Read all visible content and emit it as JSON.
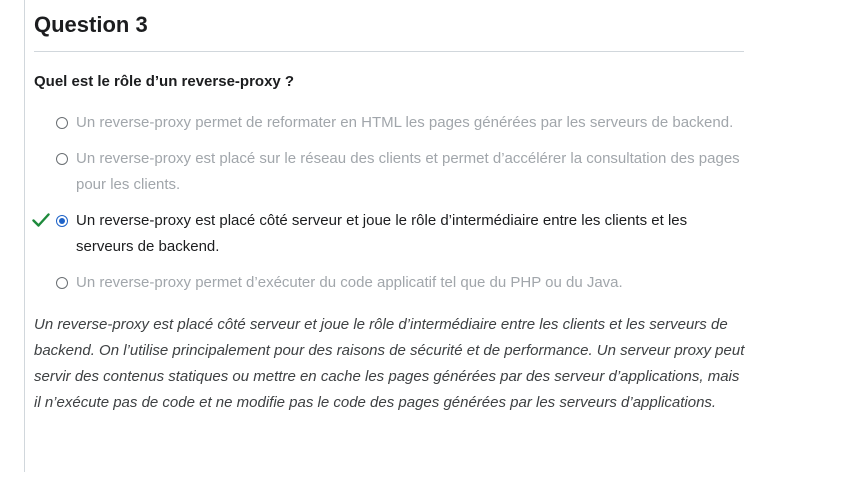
{
  "question": {
    "title": "Question 3",
    "prompt": "Quel est le rôle d’un reverse-proxy ?"
  },
  "options": [
    {
      "text": "Un reverse-proxy permet de reformater en HTML les pages générées par les serveurs de backend.",
      "selected": false,
      "correct": false
    },
    {
      "text": "Un reverse-proxy est placé sur le réseau des clients et permet d’accélérer la consultation des pages pour les clients.",
      "selected": false,
      "correct": false
    },
    {
      "text": "Un reverse-proxy est placé côté serveur et joue le rôle d’intermédiaire entre les clients et les serveurs de backend.",
      "selected": true,
      "correct": true
    },
    {
      "text": "Un reverse-proxy permet d’exécuter du code applicatif tel que du PHP ou du Java.",
      "selected": false,
      "correct": false
    }
  ],
  "explanation": "Un reverse-proxy est placé côté serveur et joue le rôle d’intermédiaire entre les clients et les serveurs de backend. On l’utilise principalement pour des raisons de sécurité et de performance. Un serveur proxy peut servir des contenus statiques ou mettre en cache les pages générées par des serveur d’applications, mais il n’exécute pas de code et ne modifie pas le code des pages générées par les serveurs d’applications.",
  "colors": {
    "correct_check": "#1e8a3c",
    "radio_selected": "#1e63c8",
    "muted_text": "#a1a6ab",
    "primary_text": "#1c1d1f"
  },
  "icons": {
    "correct": "checkmark-icon",
    "radio": "radio-icon"
  }
}
